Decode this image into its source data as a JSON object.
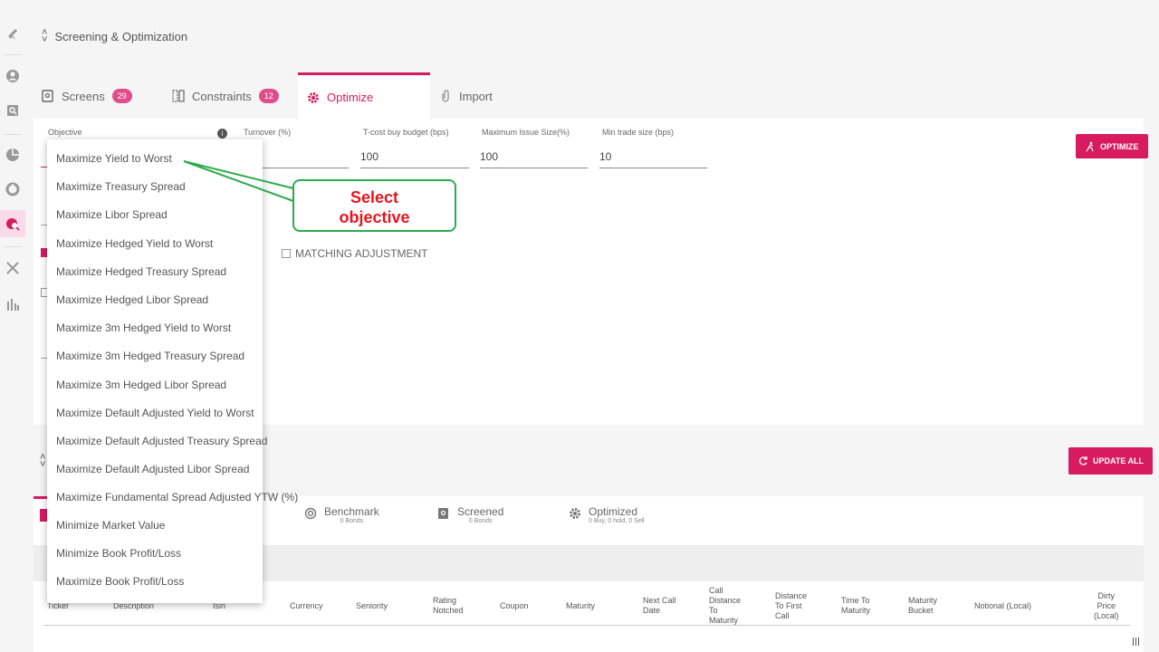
{
  "header": {
    "title": "Screening & Optimization"
  },
  "tabs": [
    {
      "label": "Screens",
      "badge": "29"
    },
    {
      "label": "Constraints",
      "badge": "12"
    },
    {
      "label": "Optimize"
    },
    {
      "label": "Import"
    }
  ],
  "form": {
    "objective_label": "Objective",
    "turnover_label": "Turnover (%)",
    "tcost_label": "T-cost buy budget (bps)",
    "tcost_value": "100",
    "max_issue_label": "Maximum Issue Size(%)",
    "max_issue_value": "100",
    "min_trade_label": "Min trade size (bps)",
    "min_trade_value": "10",
    "matching_label": "MATCHING ADJUSTMENT"
  },
  "buttons": {
    "optimize": "OPTIMIZE",
    "update_all": "UPDATE ALL"
  },
  "dropdown": {
    "options": [
      "Maximize Yield to Worst",
      "Maximize Treasury Spread",
      "Maximize Libor Spread",
      "Maximize Hedged Yield to Worst",
      "Maximize Hedged Treasury Spread",
      "Maximize Hedged Libor Spread",
      "Maximize 3m Hedged Yield to Worst",
      "Maximize 3m Hedged Treasury Spread",
      "Maximize 3m Hedged Libor Spread",
      "Maximize Default Adjusted Yield to Worst",
      "Maximize Default Adjusted Treasury Spread",
      "Maximize Default Adjusted Libor Spread",
      "Maximize Fundamental Spread Adjusted YTW (%)",
      "Minimize Market Value",
      "Minimize Book Profit/Loss",
      "Maximize Book Profit/Loss"
    ]
  },
  "callout": {
    "line1": "Select",
    "line2": "objective"
  },
  "subtabs": [
    {
      "label": "Benchmark",
      "sub": "0 Bonds"
    },
    {
      "label": "Screened",
      "sub": "0 Bonds"
    },
    {
      "label": "Optimized",
      "sub": "0 Buy, 0 hold, 0 Sell"
    }
  ],
  "columns": {
    "ticker": "Ticker",
    "description": "Description",
    "isin": "Isin",
    "currency": "Currency",
    "seniority": "Seniority",
    "rating1": "Rating",
    "rating2": "Notched",
    "coupon": "Coupon",
    "maturity": "Maturity",
    "nextcall1": "Next Call",
    "nextcall2": "Date",
    "cd1": "Call",
    "cd2": "Distance",
    "cd3": "To",
    "cd4": "Maturity",
    "dfc1": "Distance",
    "dfc2": "To First",
    "dfc3": "Call",
    "ttm1": "Time To",
    "ttm2": "Maturity",
    "mb1": "Maturity",
    "mb2": "Bucket",
    "notional": "Notional (Local)",
    "dp1": "Dirty",
    "dp2": "Price",
    "dp3": "(Local)"
  },
  "colors": {
    "accent": "#d81b60",
    "callout_border": "#2eaa4e",
    "callout_text": "#e8141e"
  }
}
